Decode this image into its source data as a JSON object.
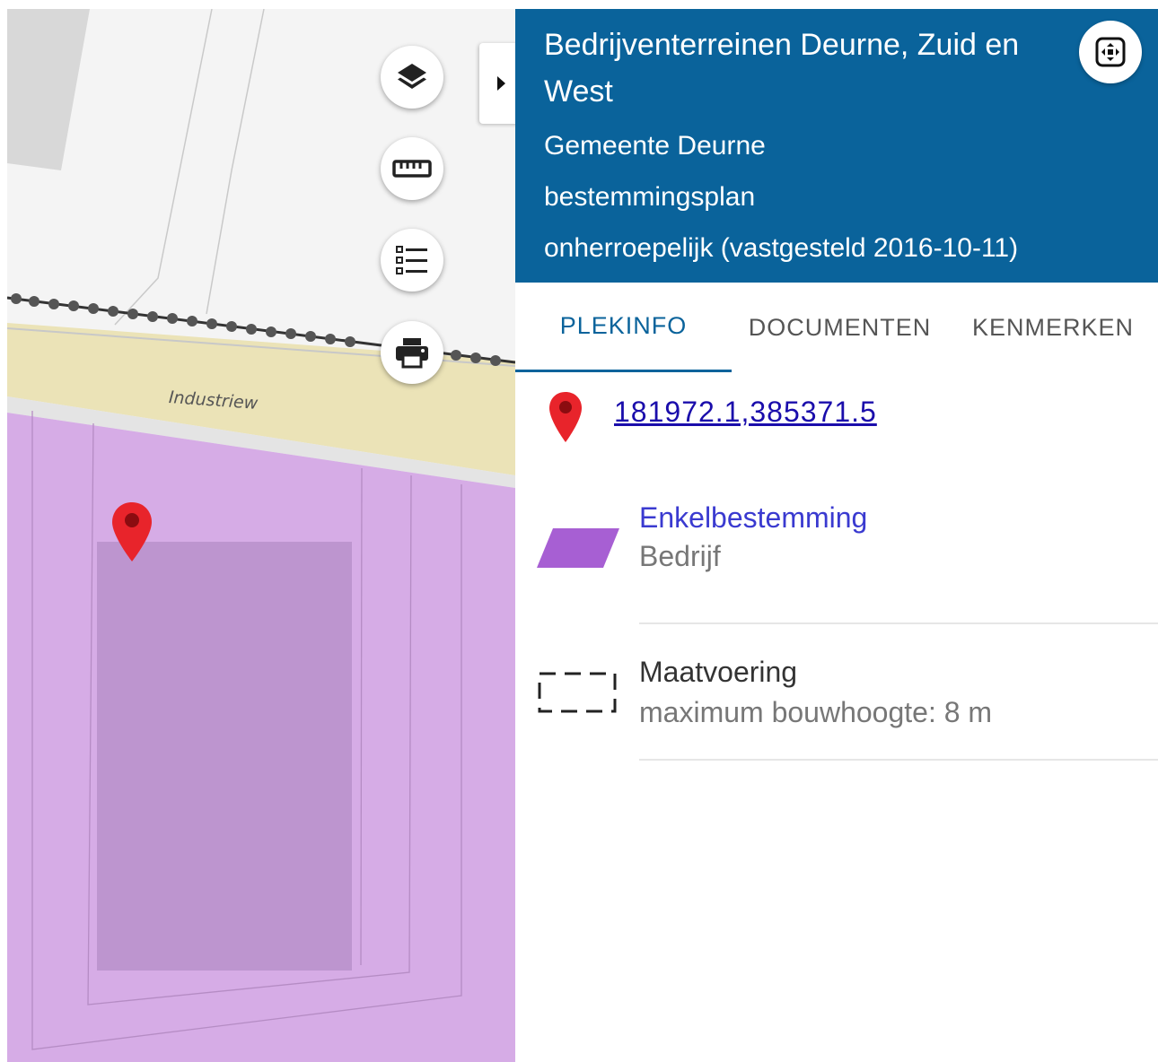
{
  "map": {
    "street_label": "Industriew",
    "controls": {
      "layers_icon": "layers-icon",
      "measure_icon": "ruler-icon",
      "legend_icon": "list-icon",
      "print_icon": "printer-icon",
      "collapse_icon": "caret-right-icon"
    },
    "colors": {
      "bedrijf_zone": "#d6ace6",
      "selected_area": "#bd95cf",
      "road": "#ebe3b7",
      "marker": "#e8242b"
    }
  },
  "panel": {
    "header": {
      "title": "Bedrijventerreinen Deurne, Zuid en West",
      "municipality": "Gemeente Deurne",
      "plan_type": "bestemmingsplan",
      "status": "onherroepelijk (vastgesteld 2016-10-11)",
      "zoom_button_icon": "fit-extent-icon",
      "background_color": "#0a639b"
    },
    "tabs": [
      {
        "label": "PLEKINFO",
        "active": true
      },
      {
        "label": "DOCUMENTEN",
        "active": false
      },
      {
        "label": "KENMERKEN",
        "active": false
      }
    ],
    "location": {
      "icon": "map-pin-icon",
      "coordinates": "181972.1,385371.5"
    },
    "items": [
      {
        "title": "Enkelbestemming",
        "subtitle": "Bedrijf",
        "swatch_color": "#a75fd3",
        "icon": "parallelogram-swatch-icon"
      },
      {
        "title": "Maatvoering",
        "subtitle": "maximum bouwhoogte: 8 m",
        "icon": "dashed-rectangle-icon"
      }
    ]
  }
}
